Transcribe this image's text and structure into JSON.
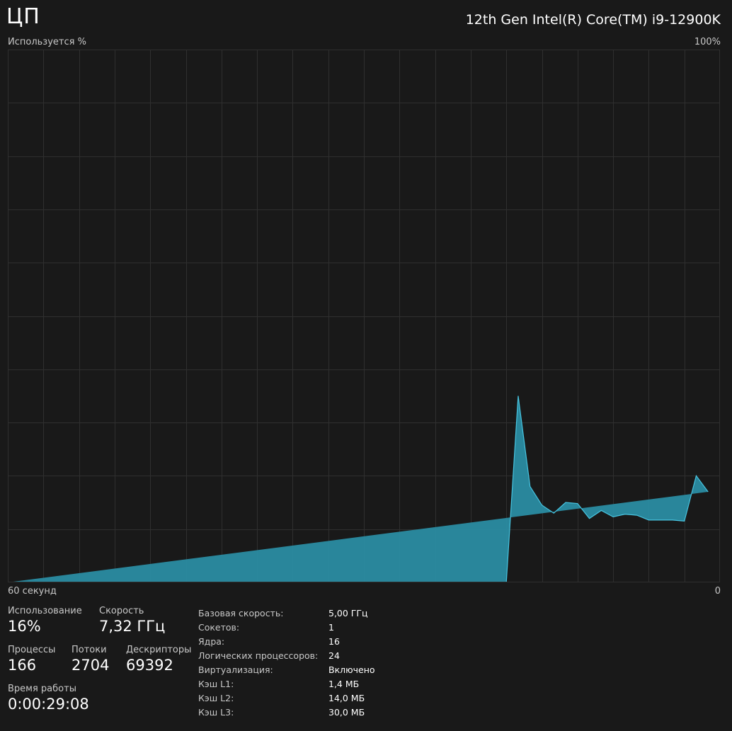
{
  "header": {
    "title": "ЦП",
    "cpu_model": "12th Gen Intel(R) Core(TM) i9-12900K"
  },
  "graph": {
    "y_label": "Используется %",
    "y_max_label": "100%",
    "x_label": "60 секунд",
    "x_min_label": "0"
  },
  "colors": {
    "background": "#191919",
    "grid": "#2f2f2f",
    "fill": "#2a8fa6",
    "stroke": "#47c4e0"
  },
  "chart_data": {
    "type": "area",
    "title": "",
    "xlabel": "60 секунд",
    "ylabel": "Используется %",
    "x_range": [
      60,
      0
    ],
    "ylim": [
      0,
      100
    ],
    "grid": true,
    "x": [
      60,
      59,
      58,
      57,
      56,
      55,
      54,
      53,
      52,
      51,
      50,
      49,
      48,
      47,
      46,
      45,
      44,
      43,
      42,
      41,
      40,
      39,
      38,
      37,
      36,
      35,
      34,
      33,
      32,
      31,
      30,
      29,
      28,
      27,
      26,
      25,
      24,
      23,
      22,
      21,
      20,
      19,
      18,
      17,
      16,
      15,
      14,
      13,
      12,
      11,
      10,
      9,
      8,
      7,
      6,
      5,
      4,
      3,
      2,
      1,
      0
    ],
    "values": [
      0,
      0,
      0,
      0,
      0,
      0,
      0,
      0,
      0,
      0,
      0,
      0,
      0,
      0,
      0,
      0,
      0,
      0,
      0,
      0,
      0,
      0,
      0,
      0,
      0,
      0,
      0,
      0,
      0,
      0,
      0,
      0,
      0,
      0,
      0,
      0,
      0,
      0,
      0,
      0,
      0,
      0,
      0,
      35,
      18,
      14.5,
      13,
      15,
      14.8,
      12,
      13.5,
      12.3,
      12.8,
      12.6,
      11.7,
      11.7,
      11.7,
      11.5,
      20,
      17
    ]
  },
  "stats": {
    "usage_label": "Использование",
    "usage_value": "16%",
    "speed_label": "Скорость",
    "speed_value": "7,32 ГГц",
    "processes_label": "Процессы",
    "processes_value": "166",
    "threads_label": "Потоки",
    "threads_value": "2704",
    "handles_label": "Дескрипторы",
    "handles_value": "69392",
    "uptime_label": "Время работы",
    "uptime_value": "0:00:29:08"
  },
  "specs": [
    {
      "key": "Базовая скорость:",
      "value": "5,00 ГГц"
    },
    {
      "key": "Сокетов:",
      "value": "1"
    },
    {
      "key": "Ядра:",
      "value": "16"
    },
    {
      "key": "Логических процессоров:",
      "value": "24"
    },
    {
      "key": "Виртуализация:",
      "value": "Включено"
    },
    {
      "key": "Кэш L1:",
      "value": "1,4 МБ"
    },
    {
      "key": "Кэш L2:",
      "value": "14,0 МБ"
    },
    {
      "key": "Кэш L3:",
      "value": "30,0 МБ"
    }
  ]
}
